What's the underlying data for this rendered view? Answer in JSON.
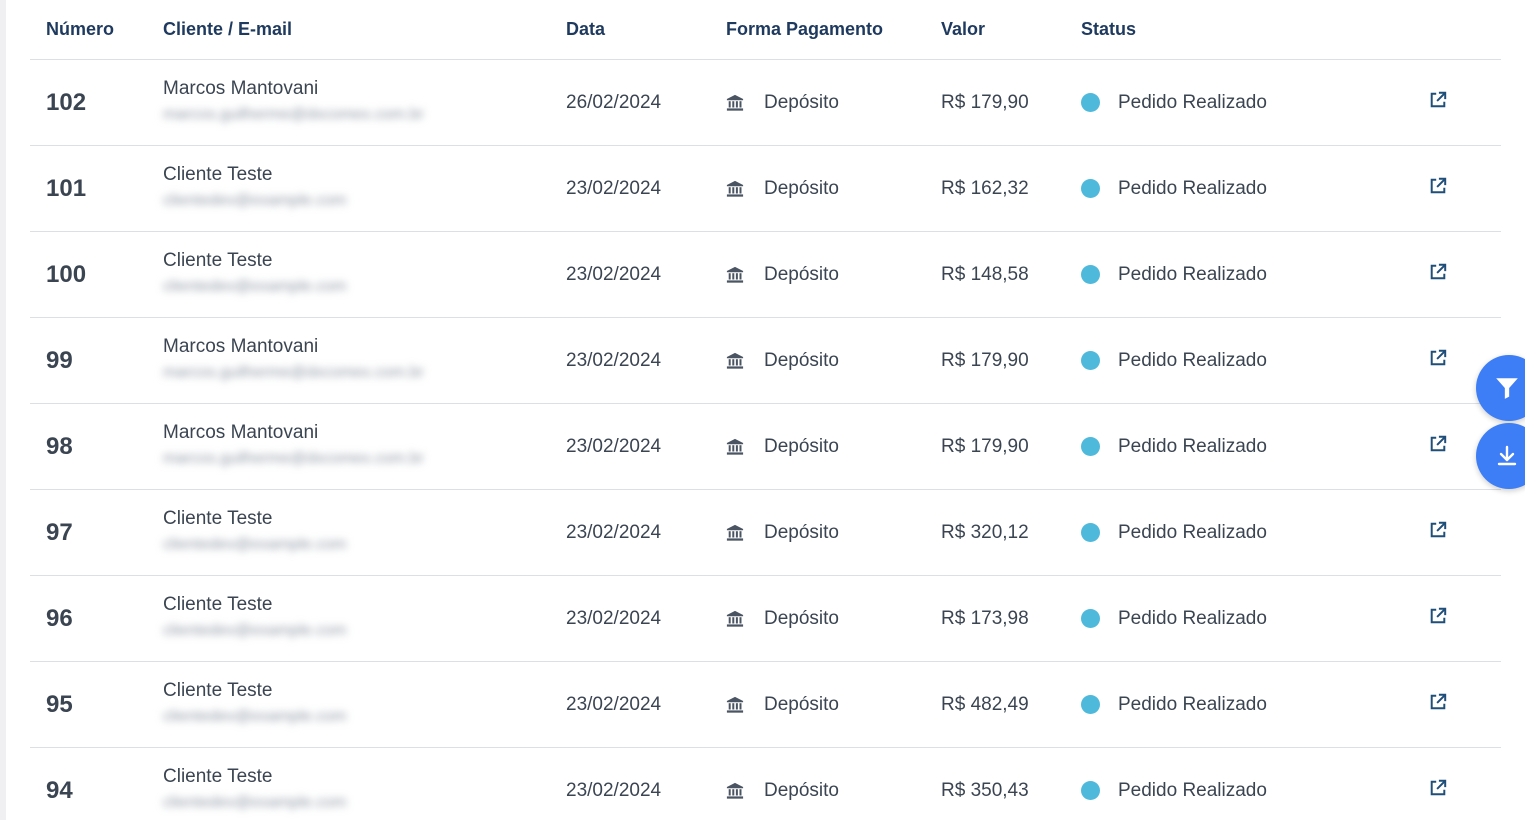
{
  "table": {
    "headers": {
      "numero": "Número",
      "cliente": "Cliente / E-mail",
      "data": "Data",
      "forma_pagamento": "Forma Pagamento",
      "valor": "Valor",
      "status": "Status"
    },
    "rows": [
      {
        "numero": "102",
        "cliente": "Marcos Mantovani",
        "email": "marcos.guilherme@dxcomex.com.br",
        "data": "26/02/2024",
        "pagamento": "Depósito",
        "valor": "R$ 179,90",
        "status": "Pedido Realizado"
      },
      {
        "numero": "101",
        "cliente": "Cliente Teste",
        "email": "clientedev@example.com",
        "data": "23/02/2024",
        "pagamento": "Depósito",
        "valor": "R$ 162,32",
        "status": "Pedido Realizado"
      },
      {
        "numero": "100",
        "cliente": "Cliente Teste",
        "email": "clientedev@example.com",
        "data": "23/02/2024",
        "pagamento": "Depósito",
        "valor": "R$ 148,58",
        "status": "Pedido Realizado"
      },
      {
        "numero": "99",
        "cliente": "Marcos Mantovani",
        "email": "marcos.guilherme@dxcomex.com.br",
        "data": "23/02/2024",
        "pagamento": "Depósito",
        "valor": "R$ 179,90",
        "status": "Pedido Realizado"
      },
      {
        "numero": "98",
        "cliente": "Marcos Mantovani",
        "email": "marcos.guilherme@dxcomex.com.br",
        "data": "23/02/2024",
        "pagamento": "Depósito",
        "valor": "R$ 179,90",
        "status": "Pedido Realizado"
      },
      {
        "numero": "97",
        "cliente": "Cliente Teste",
        "email": "clientedev@example.com",
        "data": "23/02/2024",
        "pagamento": "Depósito",
        "valor": "R$ 320,12",
        "status": "Pedido Realizado"
      },
      {
        "numero": "96",
        "cliente": "Cliente Teste",
        "email": "clientedev@example.com",
        "data": "23/02/2024",
        "pagamento": "Depósito",
        "valor": "R$ 173,98",
        "status": "Pedido Realizado"
      },
      {
        "numero": "95",
        "cliente": "Cliente Teste",
        "email": "clientedev@example.com",
        "data": "23/02/2024",
        "pagamento": "Depósito",
        "valor": "R$ 482,49",
        "status": "Pedido Realizado"
      },
      {
        "numero": "94",
        "cliente": "Cliente Teste",
        "email": "clientedev@example.com",
        "data": "23/02/2024",
        "pagamento": "Depósito",
        "valor": "R$ 350,43",
        "status": "Pedido Realizado"
      }
    ]
  },
  "icons": {
    "payment": "bank-icon",
    "action": "external-link-icon",
    "filter": "filter-icon",
    "download": "download-icon"
  },
  "colors": {
    "header_text": "#1f3a5f",
    "status_dot": "#4fb9dc",
    "fab": "#3d7df5",
    "action_icon": "#1f4e79"
  }
}
